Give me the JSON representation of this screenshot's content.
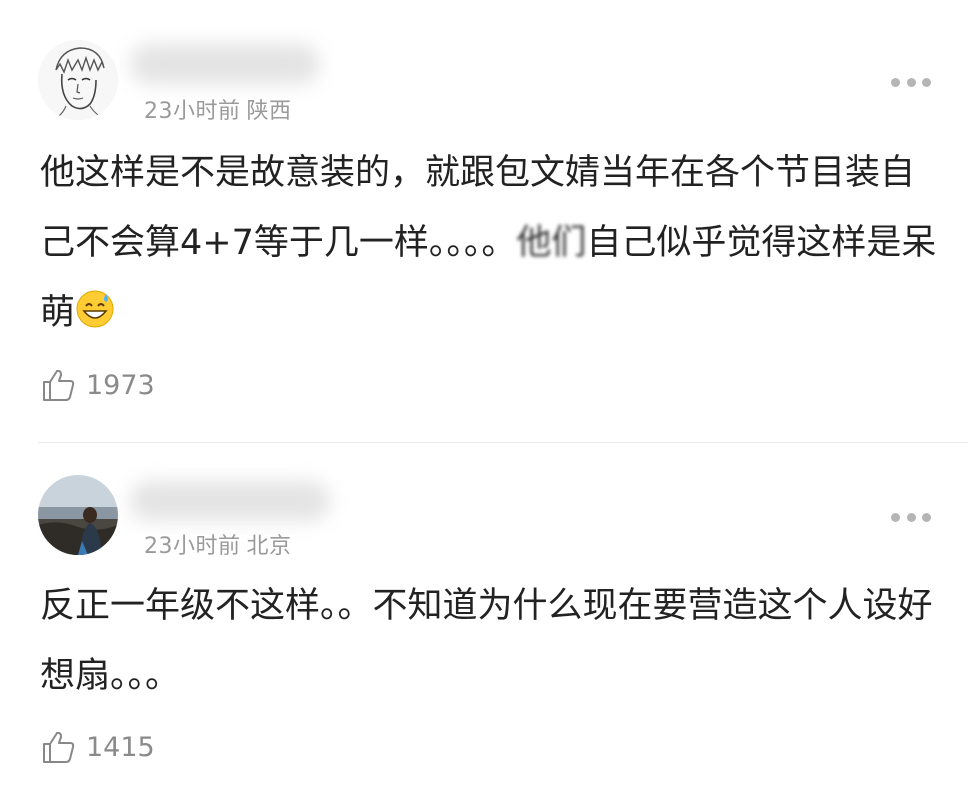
{
  "comments": [
    {
      "time": "23小时前",
      "location": "陕西",
      "text_part1": "他这样是不是故意装的，就跟包文婧当年在各个节目装自己不会算4+7等于几一样。。。。",
      "text_blurred": "他们",
      "text_part2": "自己似乎觉得这样是呆萌",
      "emoji": "sweat-smile-emoji",
      "likes": "1973",
      "avatar": "sketch-avatar"
    },
    {
      "time": "23小时前",
      "location": "北京",
      "text": "反正一年级不这样。。不知道为什么现在要营造这个人设好想扇。。。",
      "likes": "1415",
      "avatar": "seaside-photo-avatar"
    }
  ],
  "icons": {
    "like": "thumbs-up-icon",
    "more": "more-dots-icon"
  }
}
